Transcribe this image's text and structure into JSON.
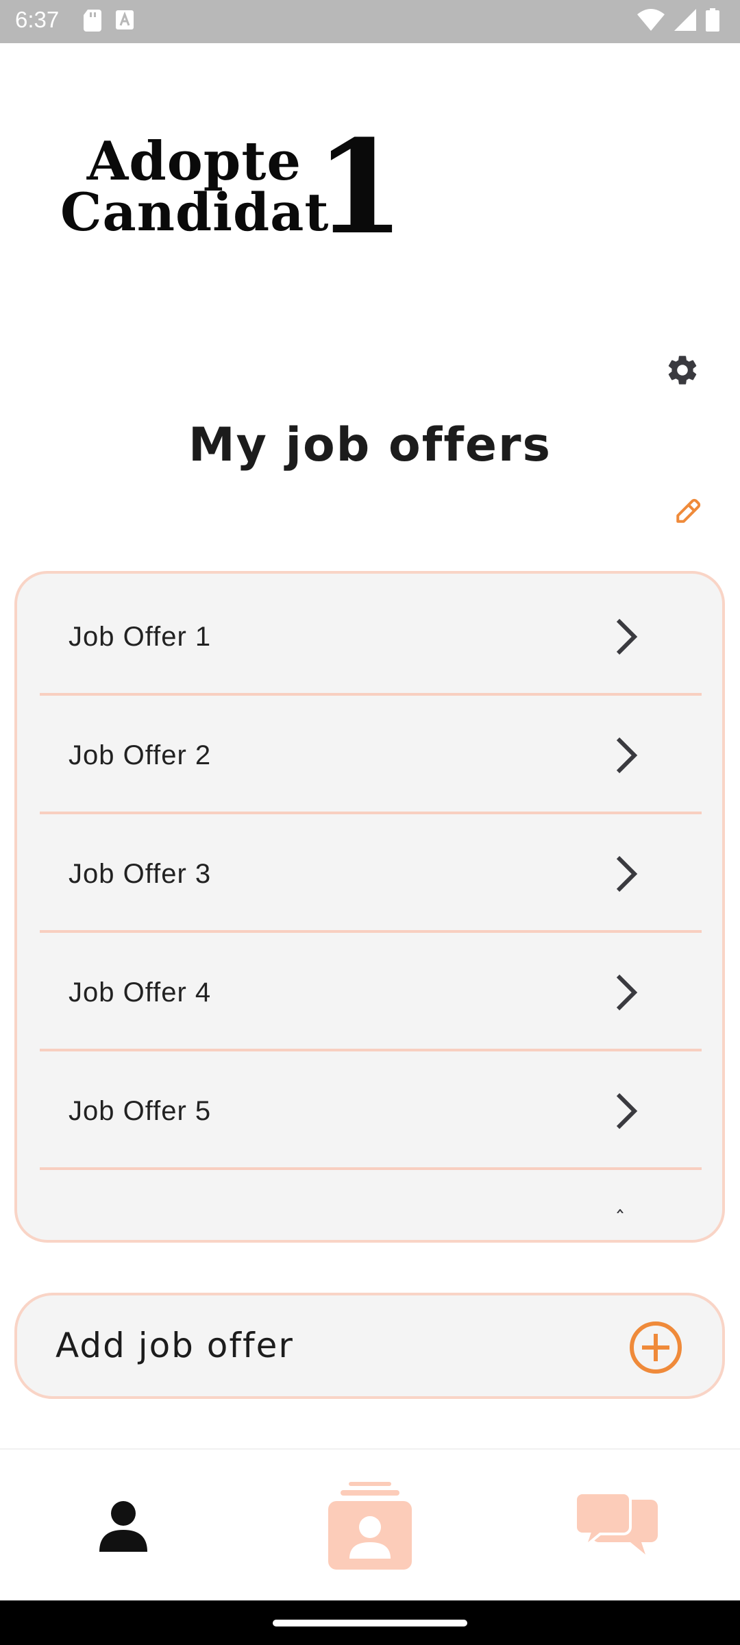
{
  "status_bar": {
    "time": "6:37",
    "left_icons": [
      "sd-card-icon",
      "text-notification-icon"
    ],
    "right_icons": [
      "wifi-icon",
      "cell-signal-icon",
      "battery-icon"
    ]
  },
  "logo": {
    "line1": "Adopte",
    "line2": "Candidat",
    "number": "1"
  },
  "page": {
    "title": "My job offers"
  },
  "job_offers": [
    {
      "label": "Job Offer 1"
    },
    {
      "label": "Job Offer 2"
    },
    {
      "label": "Job Offer 3"
    },
    {
      "label": "Job Offer 4"
    },
    {
      "label": "Job Offer 5"
    }
  ],
  "add_offer": {
    "label": "Add job offer",
    "icon": "plus-circle-icon"
  },
  "bottom_nav": {
    "items": [
      {
        "icon": "profile-icon",
        "active": true
      },
      {
        "icon": "candidate-cards-icon",
        "active": false
      },
      {
        "icon": "chat-icon",
        "active": false
      }
    ]
  },
  "colors": {
    "accent": "#ef8a3a",
    "accent_light": "#f9d4c6",
    "nav_inactive": "#fcccb9",
    "card_bg": "#f4f4f4",
    "text_dark": "#1c1c1c"
  }
}
